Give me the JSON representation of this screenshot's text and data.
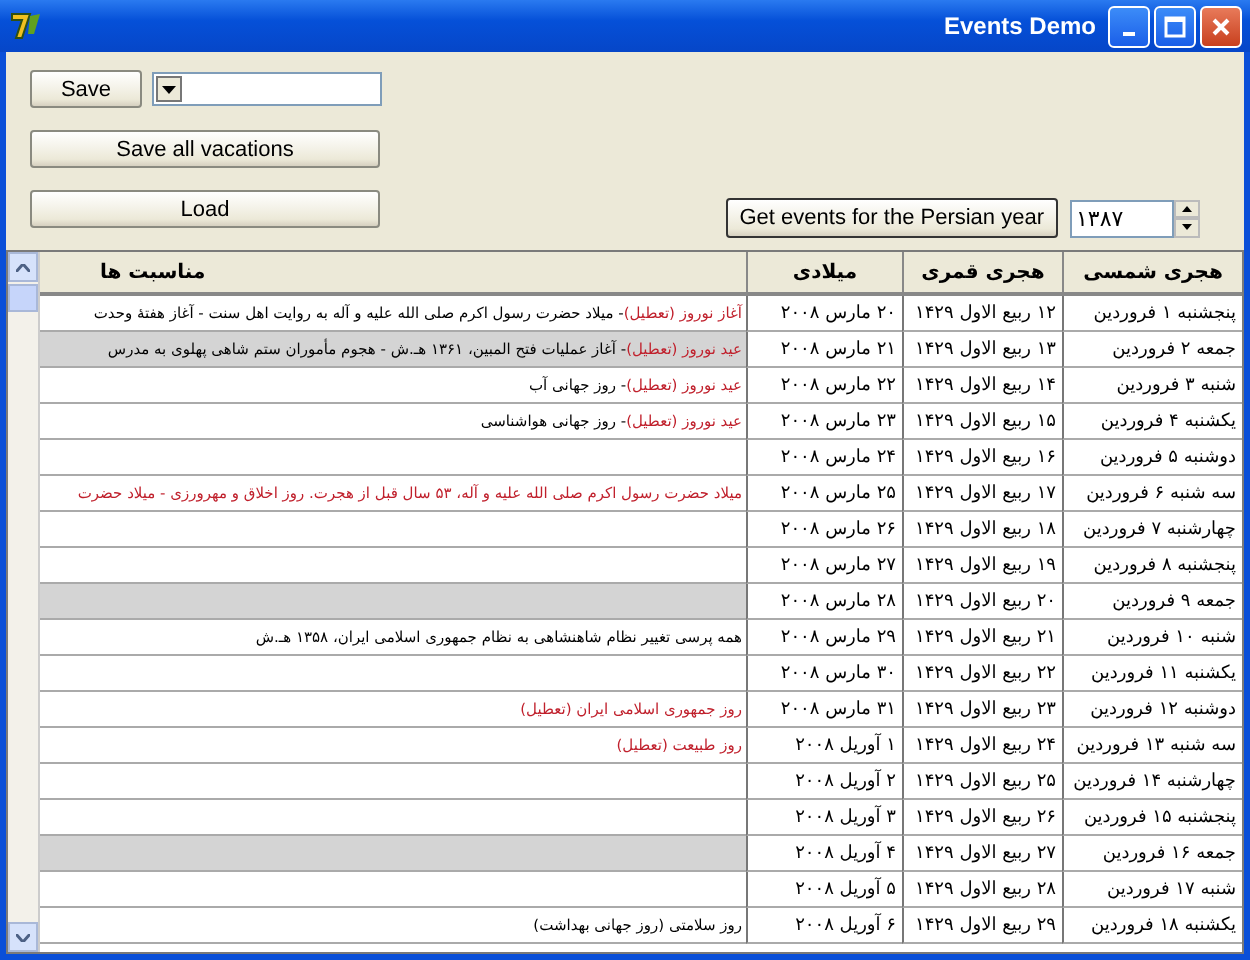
{
  "window": {
    "title": "Events Demo"
  },
  "save_button": {
    "label": "Save"
  },
  "save_all_button": {
    "label": "Save all vacations"
  },
  "load_button": {
    "label": "Load"
  },
  "year_button": {
    "label": "Get events for the Persian year"
  },
  "year_field": {
    "value": "۱۳۸۷"
  },
  "table": {
    "columns": [
      "هجری شمسی",
      "هجری قمری",
      "میلادی",
      "مناسبت ها"
    ],
    "rows": [
      {
        "shamsi": "پنجشنبه ۱ فروردین",
        "qamari": "۱۲ ربیع الاول ۱۴۲۹",
        "miladi": "۲۰ مارس ۲۰۰۸",
        "shaded": false,
        "events": [
          {
            "text": "آغاز نوروز (تعطیل)",
            "holiday": true
          },
          {
            "text": " - میلاد حضرت رسول اکرم صلی الله علیه و آله به روایت اهل سنت - آغاز هفتهٔ وحدت",
            "holiday": false
          }
        ]
      },
      {
        "shamsi": "جمعه ۲ فروردین",
        "qamari": "۱۳ ربیع الاول ۱۴۲۹",
        "miladi": "۲۱ مارس ۲۰۰۸",
        "shaded": true,
        "events": [
          {
            "text": "عید نوروز (تعطیل)",
            "holiday": true
          },
          {
            "text": " - آغاز عملیات فتح المبین، ۱۳۶۱ هـ.ش - هجوم مأموران ستم شاهی پهلوی به مدرس",
            "holiday": false
          }
        ]
      },
      {
        "shamsi": "شنبه ۳ فروردین",
        "qamari": "۱۴ ربیع الاول ۱۴۲۹",
        "miladi": "۲۲ مارس ۲۰۰۸",
        "shaded": false,
        "events": [
          {
            "text": "عید نوروز (تعطیل)",
            "holiday": true
          },
          {
            "text": " - روز جهانی آب",
            "holiday": false
          }
        ]
      },
      {
        "shamsi": "یکشنبه ۴ فروردین",
        "qamari": "۱۵ ربیع الاول ۱۴۲۹",
        "miladi": "۲۳ مارس ۲۰۰۸",
        "shaded": false,
        "events": [
          {
            "text": "عید نوروز (تعطیل)",
            "holiday": true
          },
          {
            "text": " - روز جهانی هواشناسی",
            "holiday": false
          }
        ]
      },
      {
        "shamsi": "دوشنبه ۵ فروردین",
        "qamari": "۱۶ ربیع الاول ۱۴۲۹",
        "miladi": "۲۴ مارس ۲۰۰۸",
        "shaded": false,
        "events": []
      },
      {
        "shamsi": "سه شنبه ۶ فروردین",
        "qamari": "۱۷ ربیع الاول ۱۴۲۹",
        "miladi": "۲۵ مارس ۲۰۰۸",
        "shaded": false,
        "events": [
          {
            "text": "میلاد حضرت رسول اکرم صلی الله علیه و آله، ۵۳ سال قبل از هجرت. روز اخلاق و مهرورزی - میلاد حضرت",
            "holiday": true
          }
        ]
      },
      {
        "shamsi": "چهارشنبه ۷ فروردین",
        "qamari": "۱۸ ربیع الاول ۱۴۲۹",
        "miladi": "۲۶ مارس ۲۰۰۸",
        "shaded": false,
        "events": []
      },
      {
        "shamsi": "پنجشنبه ۸ فروردین",
        "qamari": "۱۹ ربیع الاول ۱۴۲۹",
        "miladi": "۲۷ مارس ۲۰۰۸",
        "shaded": false,
        "events": []
      },
      {
        "shamsi": "جمعه ۹ فروردین",
        "qamari": "۲۰ ربیع الاول ۱۴۲۹",
        "miladi": "۲۸ مارس ۲۰۰۸",
        "shaded": true,
        "events": []
      },
      {
        "shamsi": "شنبه ۱۰ فروردین",
        "qamari": "۲۱ ربیع الاول ۱۴۲۹",
        "miladi": "۲۹ مارس ۲۰۰۸",
        "shaded": false,
        "events": [
          {
            "text": "همه پرسی تغییر نظام شاهنشاهی به نظام جمهوری اسلامی ایران، ۱۳۵۸ هـ.ش",
            "holiday": false
          }
        ]
      },
      {
        "shamsi": "یکشنبه ۱۱ فروردین",
        "qamari": "۲۲ ربیع الاول ۱۴۲۹",
        "miladi": "۳۰ مارس ۲۰۰۸",
        "shaded": false,
        "events": []
      },
      {
        "shamsi": "دوشنبه ۱۲ فروردین",
        "qamari": "۲۳ ربیع الاول ۱۴۲۹",
        "miladi": "۳۱ مارس ۲۰۰۸",
        "shaded": false,
        "events": [
          {
            "text": "روز جمهوری اسلامی ایران (تعطیل)",
            "holiday": true
          }
        ]
      },
      {
        "shamsi": "سه شنبه ۱۳ فروردین",
        "qamari": "۲۴ ربیع الاول ۱۴۲۹",
        "miladi": "۱ آوریل ۲۰۰۸",
        "shaded": false,
        "events": [
          {
            "text": "روز طبیعت (تعطیل)",
            "holiday": true
          }
        ]
      },
      {
        "shamsi": "چهارشنبه ۱۴ فروردین",
        "qamari": "۲۵ ربیع الاول ۱۴۲۹",
        "miladi": "۲ آوریل ۲۰۰۸",
        "shaded": false,
        "events": []
      },
      {
        "shamsi": "پنجشنبه ۱۵ فروردین",
        "qamari": "۲۶ ربیع الاول ۱۴۲۹",
        "miladi": "۳ آوریل ۲۰۰۸",
        "shaded": false,
        "events": []
      },
      {
        "shamsi": "جمعه ۱۶ فروردین",
        "qamari": "۲۷ ربیع الاول ۱۴۲۹",
        "miladi": "۴ آوریل ۲۰۰۸",
        "shaded": true,
        "events": []
      },
      {
        "shamsi": "شنبه ۱۷ فروردین",
        "qamari": "۲۸ ربیع الاول ۱۴۲۹",
        "miladi": "۵ آوریل ۲۰۰۸",
        "shaded": false,
        "events": []
      },
      {
        "shamsi": "یکشنبه ۱۸ فروردین",
        "qamari": "۲۹ ربیع الاول ۱۴۲۹",
        "miladi": "۶ آوریل ۲۰۰۸",
        "shaded": false,
        "events": [
          {
            "text": "روز سلامتی (روز جهانی بهداشت)",
            "holiday": false
          }
        ]
      }
    ]
  }
}
